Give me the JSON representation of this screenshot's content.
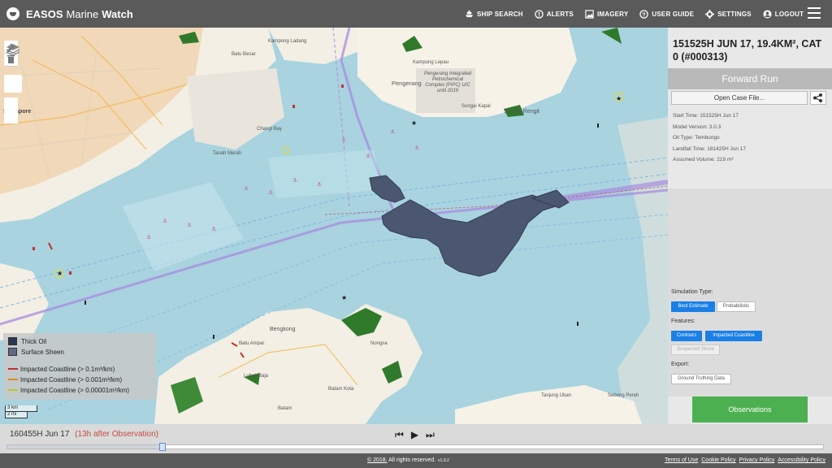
{
  "app": {
    "name_bold": "EASOS",
    "name_mid": "Marine",
    "name_end": "Watch"
  },
  "nav": [
    {
      "label": "SHIP SEARCH",
      "icon": "ship-icon"
    },
    {
      "label": "ALERTS",
      "icon": "alert-icon"
    },
    {
      "label": "IMAGERY",
      "icon": "image-icon"
    },
    {
      "label": "USER GUIDE",
      "icon": "help-icon"
    },
    {
      "label": "SETTINGS",
      "icon": "gear-icon"
    },
    {
      "label": "LOGOUT",
      "icon": "user-icon"
    }
  ],
  "map": {
    "labels": [
      "Singapore",
      "Changi Bay",
      "Pengerang",
      "Sungai Rengit",
      "Tanah Merah",
      "Nongsa",
      "Bengkong",
      "Batu Ampar",
      "Batam Kota",
      "Batam",
      "Lubuk Baja",
      "Tanjung Uban",
      "Sebong Pereh",
      "Kampong Ladang",
      "Batu Besar",
      "Kampung Lepau",
      "Pengerang Integrated Petrochemical Complex (PIPC) U/C until 2019",
      "Sungai Kapal"
    ],
    "tools": {
      "zoom_in": "+",
      "zoom_out": "−"
    },
    "legend": [
      {
        "label": "Thick Oil",
        "color": "#2c3550",
        "kind": "swatch"
      },
      {
        "label": "Surface Sheen",
        "color": "#5d6a86",
        "kind": "swatch"
      },
      {
        "label": "Impacted Coastline (> 0.1m³/km)",
        "color": "#c0302a",
        "kind": "line"
      },
      {
        "label": "Impacted Coastline (> 0.001m³/km)",
        "color": "#e08a1e",
        "kind": "line"
      },
      {
        "label": "Impacted Coastline (> 0.00001m³/km)",
        "color": "#b9c62a",
        "kind": "line"
      }
    ],
    "scale": {
      "km": "3 km",
      "mi": "2 mi"
    }
  },
  "panel": {
    "title": "151525H JUN 17, 19.4KM², CAT 0 (#000313)",
    "mode": "Forward Run",
    "open_case": "Open Case File...",
    "info": [
      "Start Time: 151525H Jun 17",
      "Model Version: 3.0.3",
      "Oil Type: Tembungo",
      "Landfall Time: 181425H Jun 17",
      "Assumed Volume: 219 m³"
    ],
    "simulation_type_label": "Simulation Type:",
    "sim_best": "Best Estimate",
    "sim_prob": "Probabilistic",
    "features_label": "Features:",
    "feat_contours": "Contours",
    "feat_coast": "Impacted Coastline",
    "feat_shore": "Suspected Shore",
    "export_label": "Export:",
    "export_gt": "Ground Truthing Data",
    "observations": "Observations"
  },
  "timebar": {
    "date": "160455H Jun 17",
    "relative": "(13h after Observation)",
    "progress": 0.19
  },
  "footer": {
    "copyright": "© 2018.",
    "rights": " All rights reserved.",
    "version": "v1.9.2",
    "links": [
      "Terms of Use",
      "Cookie Policy",
      "Privacy Policy",
      "Accessibility Policy"
    ]
  },
  "colors": {
    "accent": "#1a7fe6",
    "observations": "#4cb050",
    "oil_thick": "#2c3550",
    "sea": "#a8d3df"
  }
}
